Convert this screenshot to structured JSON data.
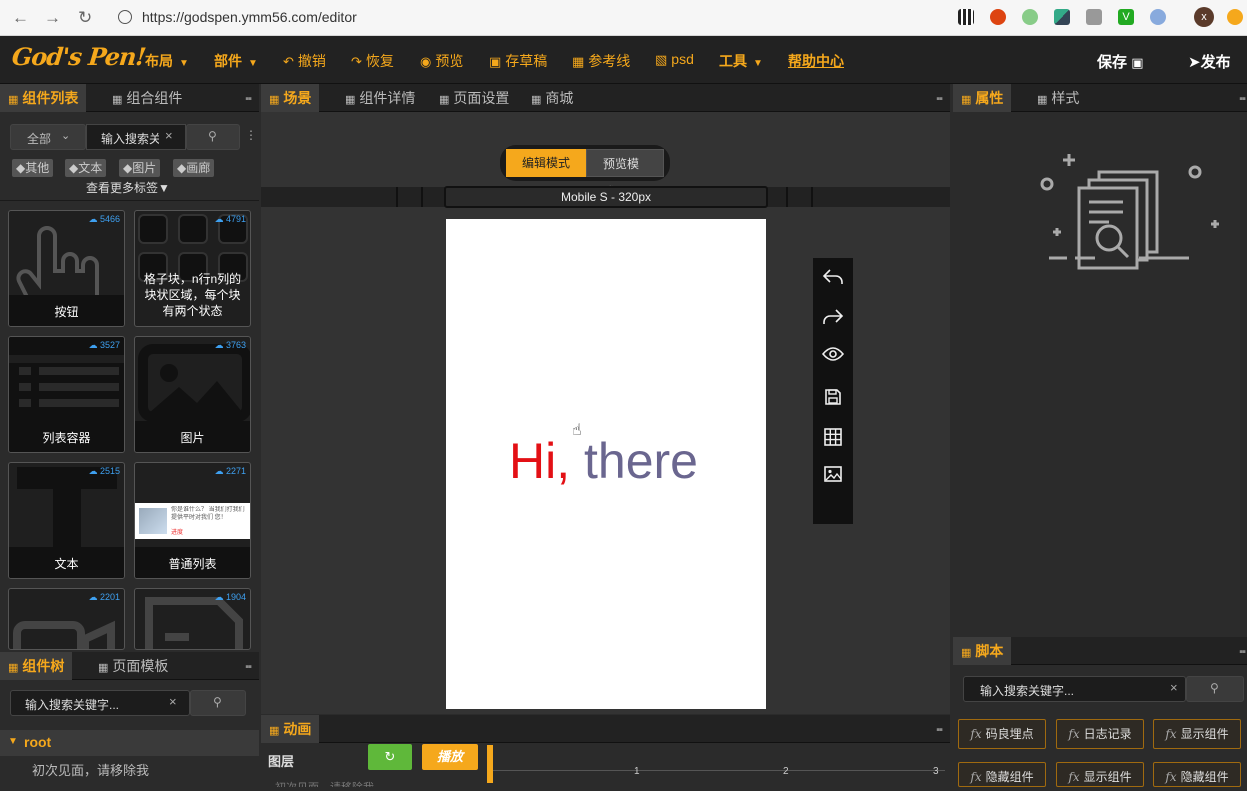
{
  "browser": {
    "url": "https://godspen.ymm56.com/editor",
    "profile_initial": "x"
  },
  "header": {
    "logo": "God's Pen!",
    "menu": {
      "layout": "布局",
      "components": "部件",
      "undo": "撤销",
      "redo": "恢复",
      "preview": "预览",
      "draft": "存草稿",
      "guides": "参考线",
      "psd": "psd",
      "tools": "工具",
      "help": "帮助中心"
    },
    "save": "保存",
    "publish": "发布"
  },
  "left_panel": {
    "tabs": [
      "组件列表",
      "组合组件"
    ],
    "filter": "全部",
    "search_placeholder": "输入搜索关键字...",
    "search_value": "输入搜索关",
    "tags": [
      "其他",
      "文本",
      "图片",
      "画廊"
    ],
    "more_tags": "查看更多标签▼",
    "components": [
      {
        "name": "按钮",
        "count": "5466"
      },
      {
        "name": "格子块，n行n列的块状区域，每个块有两个状态",
        "count": "4791"
      },
      {
        "name": "列表容器",
        "count": "3527"
      },
      {
        "name": "图片",
        "count": "3763"
      },
      {
        "name": "文本",
        "count": "2515"
      },
      {
        "name": "普通列表",
        "count": "2271"
      },
      {
        "name": "",
        "count": "2201"
      },
      {
        "name": "",
        "count": "1904"
      }
    ],
    "list_preview_text": "你是谁什么？ 当我们打我们提供平时对我们 您！",
    "list_preview_tag": "进度"
  },
  "tree_panel": {
    "tabs": [
      "组件树",
      "页面模板"
    ],
    "search_placeholder": "输入搜索关键字...",
    "root": "root",
    "child": "初次见面，请移除我"
  },
  "center": {
    "tabs": [
      "场景",
      "组件详情",
      "页面设置",
      "商城"
    ],
    "mode_edit": "编辑模式",
    "mode_preview": "预览模式",
    "device": "Mobile S - 320px",
    "canvas_text_red": "Hi,",
    "canvas_text_rest": " there"
  },
  "animation": {
    "tab": "动画",
    "layer_label": "图层",
    "play": "播放",
    "ticks": [
      "1",
      "2",
      "3"
    ],
    "row_text": "初次见面，请移除我"
  },
  "right_panel": {
    "tabs": [
      "属性",
      "样式"
    ]
  },
  "script_panel": {
    "tab": "脚本",
    "search_placeholder": "输入搜索关键字...",
    "buttons": [
      "码良埋点",
      "日志记录",
      "显示组件",
      "隐藏组件",
      "显示组件",
      "隐藏组件"
    ]
  },
  "colors": {
    "accent": "#f5a81c",
    "play_green": "#5fb83a",
    "count_blue": "#3ea0f0",
    "hi_red": "#e31015",
    "hi_purple": "#6a668f"
  }
}
